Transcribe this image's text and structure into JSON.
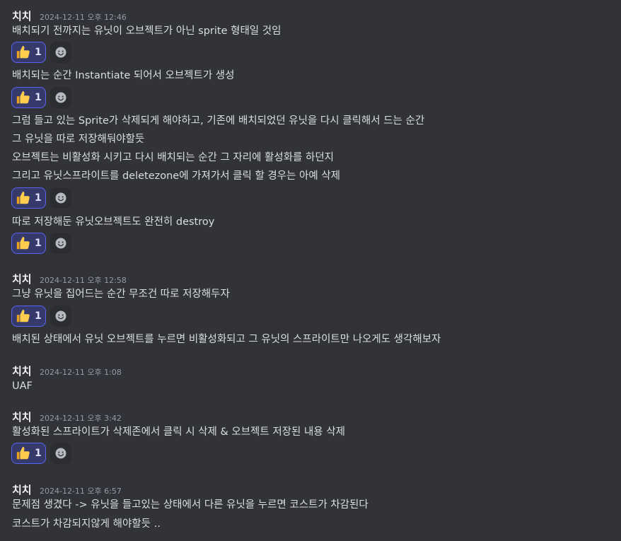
{
  "groups": [
    {
      "author": "치치",
      "timestamp": "2024-12-11 오후 12:46",
      "lines": [
        "배치되기 전까지는 유닛이 오브젝트가 아닌 sprite 형태일 것임"
      ],
      "reaction": {
        "emoji": "thumbs-up",
        "count": "1"
      },
      "continuations": [
        {
          "lines": [
            "배치되는 순간 Instantiate 되어서 오브젝트가 생성"
          ],
          "reaction": {
            "emoji": "thumbs-up",
            "count": "1"
          }
        },
        {
          "lines": [
            "그럼 들고 있는 Sprite가 삭제되게 해야하고, 기존에 배치되었던 유닛을 다시 클릭해서 드는 순간",
            "그 유닛을 따로 저장해둬야할듯",
            "오브젝트는 비활성화 시키고 다시 배치되는 순간 그 자리에 활성화를 하던지",
            "그리고 유닛스프라이트를 deletezone에 가져가서 클릭 할 경우는 아예 삭제"
          ],
          "reaction": {
            "emoji": "thumbs-up",
            "count": "1"
          }
        },
        {
          "lines": [
            "따로 저장해둔 유닛오브젝트도 완전히 destroy"
          ],
          "reaction": {
            "emoji": "thumbs-up",
            "count": "1"
          }
        }
      ]
    },
    {
      "author": "치치",
      "timestamp": "2024-12-11 오후 12:58",
      "lines": [
        "그냥 유닛을 집어드는 순간 무조건 따로 저장해두자"
      ],
      "reaction": {
        "emoji": "thumbs-up",
        "count": "1"
      },
      "continuations": [
        {
          "lines": [
            "배치된 상태에서 유닛 오브젝트를 누르면 비활성화되고 그 유닛의 스프라이트만 나오게도 생각해보자"
          ]
        }
      ]
    },
    {
      "author": "치치",
      "timestamp": "2024-12-11 오후 1:08",
      "lines": [
        "UAF"
      ]
    },
    {
      "author": "치치",
      "timestamp": "2024-12-11 오후 3:42",
      "lines": [
        "활성화된 스프라이트가 삭제존에서 클릭 시 삭제 & 오브젝트 저장된 내용 삭제"
      ],
      "reaction": {
        "emoji": "thumbs-up",
        "count": "1"
      }
    },
    {
      "author": "치치",
      "timestamp": "2024-12-11 오후 6:57",
      "lines": [
        "문제점 생겼다 -> 유닛을 들고있는 상태에서 다른 유닛을 누르면 코스트가 차감된다",
        "코스트가 차감되지않게 해야할듯 .."
      ]
    }
  ],
  "colors": {
    "background": "#313338",
    "text": "#dbdee1",
    "author": "#f2f3f5",
    "timestamp": "#949ba4",
    "reaction_bg": "#353a6b",
    "reaction_border": "#5865f2"
  },
  "icons": {
    "reaction": "thumbs-up-icon",
    "add_reaction": "add-reaction-icon"
  }
}
